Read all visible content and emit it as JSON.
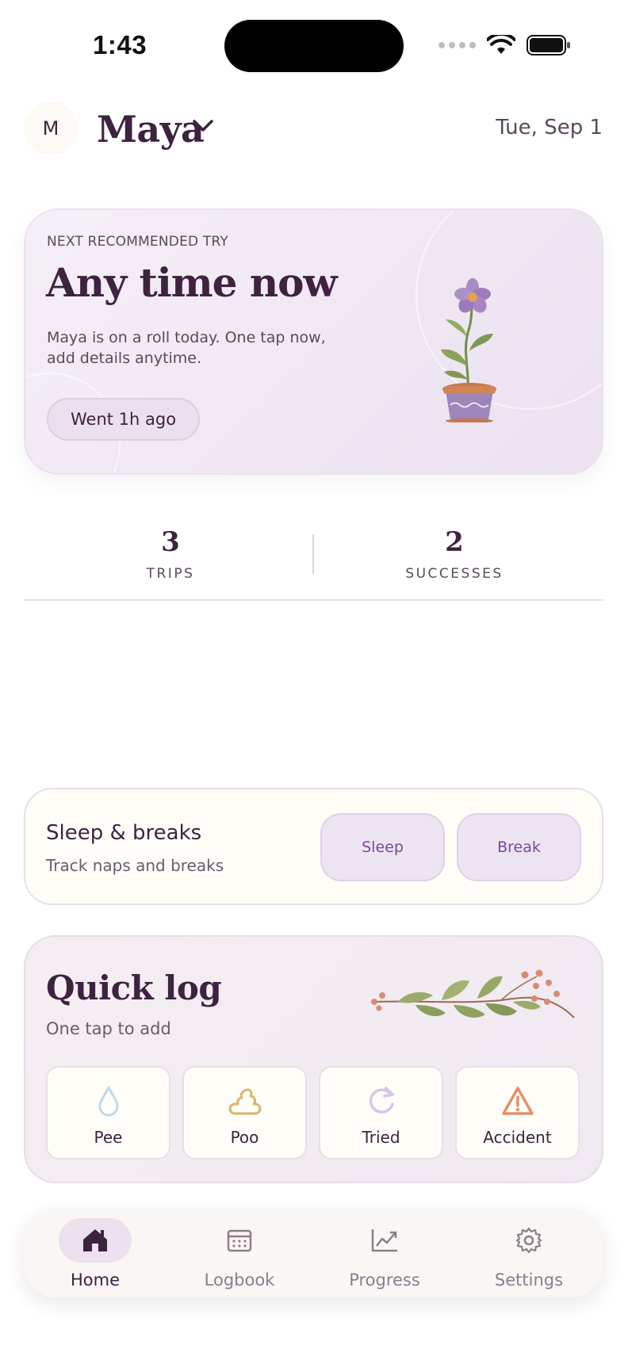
{
  "status_bar": {
    "time": "1:43"
  },
  "header": {
    "avatar_initial": "M",
    "child_name": "Maya",
    "date": "Tue, Sep 1"
  },
  "hero": {
    "kicker": "NEXT RECOMMENDED TRY",
    "title": "Any time now",
    "description": "Maya is on a roll today. One tap now, add details anytime.",
    "last_trip_pill": "Went 1h ago"
  },
  "stats": [
    {
      "value": "3",
      "label": "TRIPS"
    },
    {
      "value": "2",
      "label": "SUCCESSES"
    }
  ],
  "sleep_card": {
    "title": "Sleep & breaks",
    "subtitle": "Track naps and breaks",
    "sleep_button": "Sleep",
    "break_button": "Break"
  },
  "quick_log": {
    "title": "Quick log",
    "subtitle": "One tap to add",
    "buttons": [
      {
        "label": "Pee",
        "icon": "droplet-icon",
        "color": "#bcd9ea"
      },
      {
        "label": "Poo",
        "icon": "poo-icon",
        "color": "#d9b66c"
      },
      {
        "label": "Tried",
        "icon": "retry-icon",
        "color": "#d9c6e6"
      },
      {
        "label": "Accident",
        "icon": "warning-icon",
        "color": "#e0926a"
      }
    ]
  },
  "tab_bar": {
    "tabs": [
      {
        "label": "Home",
        "icon": "home-icon",
        "active": true
      },
      {
        "label": "Logbook",
        "icon": "calendar-icon",
        "active": false
      },
      {
        "label": "Progress",
        "icon": "chart-icon",
        "active": false
      },
      {
        "label": "Settings",
        "icon": "gear-icon",
        "active": false
      }
    ]
  },
  "colors": {
    "primary_text": "#3d2340",
    "accent_purple": "#7a4a9c",
    "card_lavender": "#f1e9f1",
    "card_cream": "#fffdf8"
  }
}
